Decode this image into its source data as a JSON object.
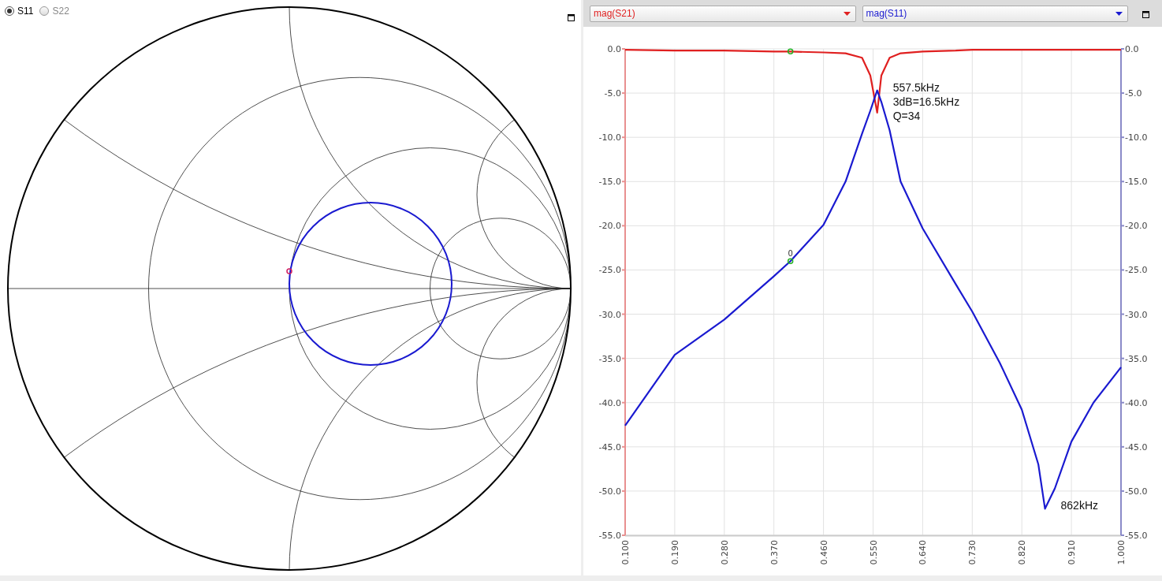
{
  "smith_panel": {
    "ports": [
      {
        "label": "S11",
        "selected": true
      },
      {
        "label": "S22",
        "selected": false
      }
    ]
  },
  "plot_panel": {
    "chart_data": {
      "type": "line",
      "grid": true,
      "xlim": [
        0.1,
        1.0
      ],
      "ylim": [
        -55,
        0
      ],
      "y2lim": [
        -55,
        0
      ],
      "x": [
        0.1,
        0.19,
        0.28,
        0.37,
        0.4,
        0.46,
        0.5,
        0.53,
        0.545,
        0.5575,
        0.565,
        0.58,
        0.6,
        0.64,
        0.7,
        0.73,
        0.78,
        0.82,
        0.85,
        0.862,
        0.88,
        0.91,
        0.95,
        1.0
      ],
      "series": [
        {
          "name": "mag(S21)",
          "color": "#e02020",
          "values": [
            -0.1,
            -0.2,
            -0.2,
            -0.3,
            -0.3,
            -0.4,
            -0.5,
            -1.0,
            -3.0,
            -7.2,
            -3.0,
            -1.0,
            -0.5,
            -0.3,
            -0.2,
            -0.1,
            -0.1,
            -0.1,
            -0.1,
            -0.1,
            -0.1,
            -0.1,
            -0.1,
            -0.1
          ]
        },
        {
          "name": "mag(S11)",
          "color": "#1a1ad0",
          "values": [
            -42.6,
            -34.6,
            -30.6,
            -25.7,
            -24.0,
            -19.9,
            -15.0,
            -9.6,
            -7.0,
            -4.7,
            -6.0,
            -9.2,
            -15.0,
            -20.3,
            -26.6,
            -29.7,
            -35.5,
            -40.8,
            -47.0,
            -52.0,
            -49.7,
            -44.4,
            -40.0,
            -36.0
          ]
        }
      ],
      "xticks": [
        {
          "value": 0.1,
          "label": "0.100"
        },
        {
          "value": 0.19,
          "label": "0.190"
        },
        {
          "value": 0.28,
          "label": "0.280"
        },
        {
          "value": 0.37,
          "label": "0.370"
        },
        {
          "value": 0.46,
          "label": "0.460"
        },
        {
          "value": 0.55,
          "label": "0.550"
        },
        {
          "value": 0.64,
          "label": "0.640"
        },
        {
          "value": 0.73,
          "label": "0.730"
        },
        {
          "value": 0.82,
          "label": "0.820"
        },
        {
          "value": 0.91,
          "label": "0.910"
        },
        {
          "value": 1.0,
          "label": "1.000"
        }
      ],
      "yticks": [
        {
          "value": 0,
          "label": "0.0"
        },
        {
          "value": -5,
          "label": "-5.0"
        },
        {
          "value": -10,
          "label": "-10.0"
        },
        {
          "value": -15,
          "label": "-15.0"
        },
        {
          "value": -20,
          "label": "-20.0"
        },
        {
          "value": -25,
          "label": "-25.0"
        },
        {
          "value": -30,
          "label": "-30.0"
        },
        {
          "value": -35,
          "label": "-35.0"
        },
        {
          "value": -40,
          "label": "-40.0"
        },
        {
          "value": -45,
          "label": "-45.0"
        },
        {
          "value": -50,
          "label": "-50.0"
        },
        {
          "value": -55,
          "label": "-55.0"
        }
      ],
      "y2ticks": [
        {
          "value": 0,
          "label": "0.0"
        },
        {
          "value": -5,
          "label": "-5.0"
        },
        {
          "value": -10,
          "label": "-10.0"
        },
        {
          "value": -15,
          "label": "-15.0"
        },
        {
          "value": -20,
          "label": "-20.0"
        },
        {
          "value": -25,
          "label": "-25.0"
        },
        {
          "value": -30,
          "label": "-30.0"
        },
        {
          "value": -35,
          "label": "-35.0"
        },
        {
          "value": -40,
          "label": "-40.0"
        },
        {
          "value": -45,
          "label": "-45.0"
        },
        {
          "value": -50,
          "label": "-50.0"
        },
        {
          "value": -55,
          "label": "-55.0"
        }
      ],
      "annotations": [
        "557.5kHz",
        "3dB=16.5kHz",
        "Q=34",
        "862kHz",
        {
          "text": "0",
          "x": 0.4,
          "y": -24.0
        }
      ]
    }
  }
}
